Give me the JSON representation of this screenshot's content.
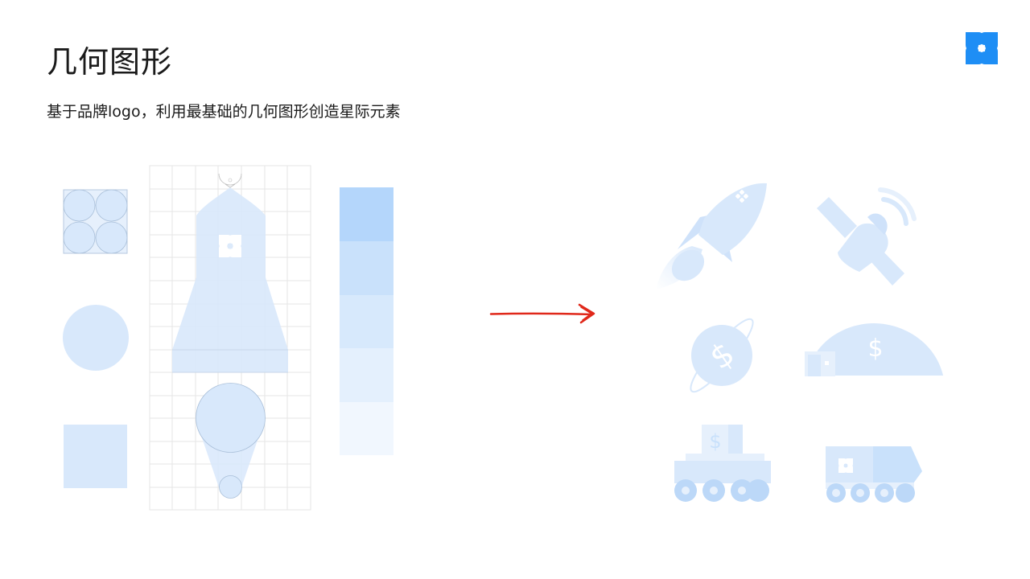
{
  "slide": {
    "title": "几何图形",
    "subtitle": "基于品牌logo，利用最基础的几何图形创造星际元素"
  },
  "icons": {
    "brand": "brand-logo-icon",
    "source_shapes": [
      "four-circles-icon",
      "circle-icon",
      "square-icon"
    ],
    "construction": "rocket-construction-grid",
    "palette": "blue-tint-swatches",
    "arrow": "red-arrow-icon",
    "results": [
      "rocket-icon",
      "satellite-icon",
      "planet-coin-icon",
      "dome-base-icon",
      "coin-rover-icon",
      "truck-rover-icon"
    ]
  },
  "colors": {
    "brand_blue": "#1e8ef5",
    "shape_blue": "#d8e8fb",
    "arrow_red": "#e0281a",
    "swatches": [
      "#b4d6fb",
      "#c9e1fb",
      "#d7e9fc",
      "#e4f0fd",
      "#f1f7fe",
      "#ffffff"
    ]
  }
}
